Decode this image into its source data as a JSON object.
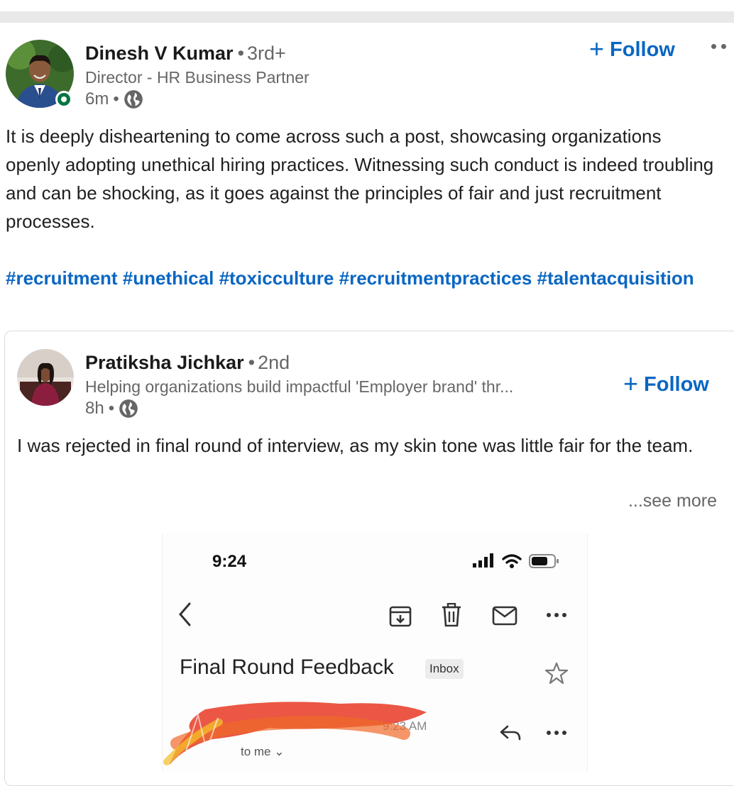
{
  "post": {
    "author": {
      "name": "Dinesh V Kumar",
      "degree": "3rd+",
      "headline": "Director - HR Business Partner",
      "time": "6m"
    },
    "follow_label": "Follow",
    "text": "It is deeply disheartening to come across such a post, showcasing organizations openly adopting unethical hiring practices. Witnessing such conduct is indeed troubling and can be shocking, as it goes against the principles of fair and just recruitment processes.",
    "hashtags": [
      "#recruitment",
      "#unethical",
      "#toxicculture",
      "#recruitmentpractices",
      "#talentacquisition"
    ]
  },
  "reshared": {
    "author": {
      "name": "Pratiksha Jichkar",
      "degree": "2nd",
      "headline": "Helping organizations build impactful 'Employer brand' thr...",
      "time": "8h"
    },
    "follow_label": "Follow",
    "text": "I was rejected in final round of interview, as my skin tone was little fair for the team.",
    "see_more_label": "...see more"
  },
  "screenshot": {
    "status_time": "9:24",
    "subject": "Final Round Feedback",
    "label_badge": "Inbox",
    "sent_time_partial": "9:23 AM",
    "to_me": "to me"
  },
  "icons": {
    "globe": "globe-icon",
    "plus": "plus-icon",
    "more": "more-horizontal-icon",
    "back": "chevron-left-icon",
    "archive": "archive-icon",
    "trash": "trash-icon",
    "mail": "mail-icon",
    "star": "star-icon",
    "reply": "reply-icon",
    "signal": "signal-icon",
    "wifi": "wifi-icon",
    "battery": "battery-icon"
  },
  "colors": {
    "link_blue": "#0a66c2",
    "secondary_text": "#666666",
    "online_green": "#057642",
    "redaction_red": "#e8402a"
  }
}
